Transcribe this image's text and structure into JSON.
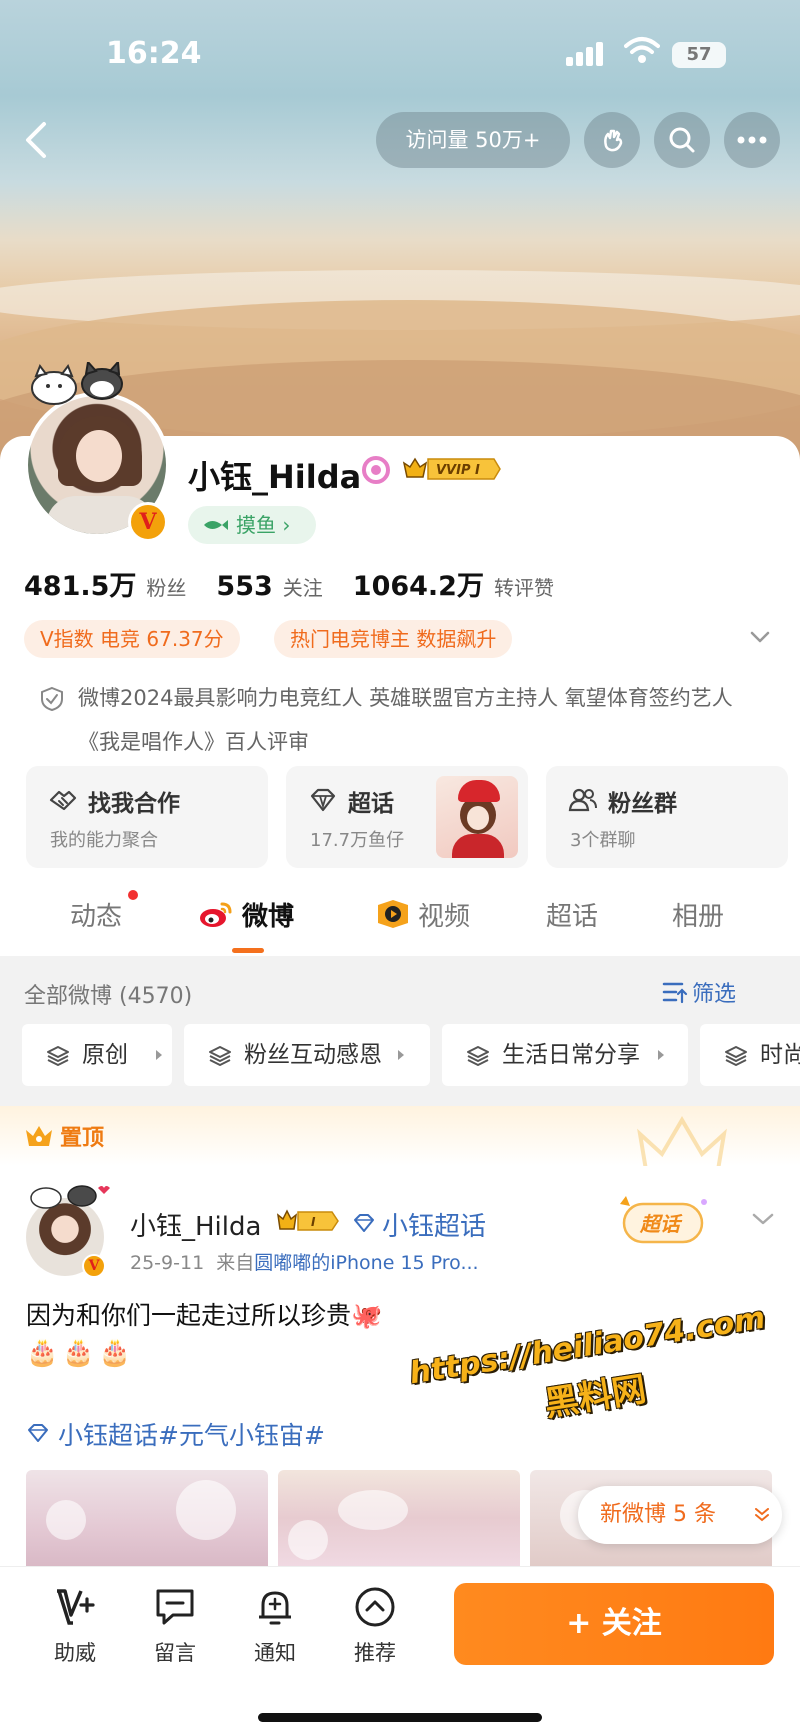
{
  "status_bar": {
    "time": "16:24",
    "battery": "57"
  },
  "header": {
    "visits": "访问量 50万+"
  },
  "profile": {
    "name": "小钰_Hilda",
    "tag": "摸鱼 ›",
    "stats": [
      {
        "value": "481.5万",
        "label": "粉丝"
      },
      {
        "value": "553",
        "label": "关注"
      },
      {
        "value": "1064.2万",
        "label": "转评赞"
      }
    ],
    "chips": [
      "V指数 电竞 67.37分",
      "热门电竞博主 数据飙升"
    ],
    "verification": "微博2024最具影响力电竞红人 英雄联盟官方主持人 氧望体育签约艺人 《我是唱作人》百人评审"
  },
  "feature_cards": [
    {
      "title": "找我合作",
      "subtitle": "我的能力聚合"
    },
    {
      "title": "超话",
      "subtitle": "17.7万鱼仔"
    },
    {
      "title": "粉丝群",
      "subtitle": "3个群聊"
    }
  ],
  "tabs": [
    "动态",
    "微博",
    "视频",
    "超话",
    "相册"
  ],
  "feed": {
    "all_label": "全部微博 (4570)",
    "filter_label": "筛选",
    "filter_chips": [
      "原创",
      "粉丝互动感恩",
      "生活日常分享",
      "时尚"
    ]
  },
  "pinned_label": "置顶",
  "post": {
    "author": "小钰_Hilda",
    "super_topic": "小钰超话",
    "date": "25-9-11",
    "source_prefix": "来自",
    "source": "圆嘟嘟的iPhone 15 Pro...",
    "content": "因为和你们一起走过所以珍贵🐙",
    "cakes": "🎂🎂🎂",
    "topic": "小钰超话#元气小钰宙#",
    "sticker": "超话"
  },
  "new_posts": "新微博 5 条",
  "watermark": {
    "line1": "https://heiliao74.com",
    "line2": "黑料网"
  },
  "bottom_nav": [
    {
      "label": "助威"
    },
    {
      "label": "留言"
    },
    {
      "label": "通知"
    },
    {
      "label": "推荐"
    }
  ],
  "follow_button": "+ 关注",
  "colors": {
    "accent": "#ff7a12",
    "link": "#3a6dbd",
    "chip_text": "#f06b1d"
  }
}
